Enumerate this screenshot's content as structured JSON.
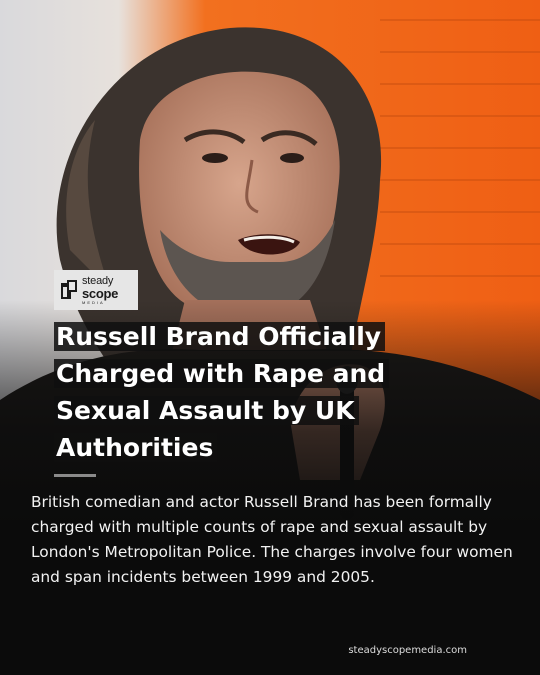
{
  "brand": {
    "logo_line1": "steady",
    "logo_line2": "scope",
    "logo_line3": "MEDIA"
  },
  "article": {
    "headline_lines": [
      "Russell Brand Officially",
      "Charged with Rape and",
      "Sexual Assault by UK",
      "Authorities"
    ],
    "body": "British comedian and actor Russell Brand has been formally charged with multiple counts of rape and sexual assault by London's Metropolitan Police. The charges involve four women and span incidents between 1999 and 2005."
  },
  "footer": {
    "website": "steadyscopemedia.com"
  },
  "colors": {
    "background": "#0b0b0b",
    "accent_orange": "#f26a1b",
    "text": "#ffffff",
    "logo_bg": "#e6e6e6"
  }
}
